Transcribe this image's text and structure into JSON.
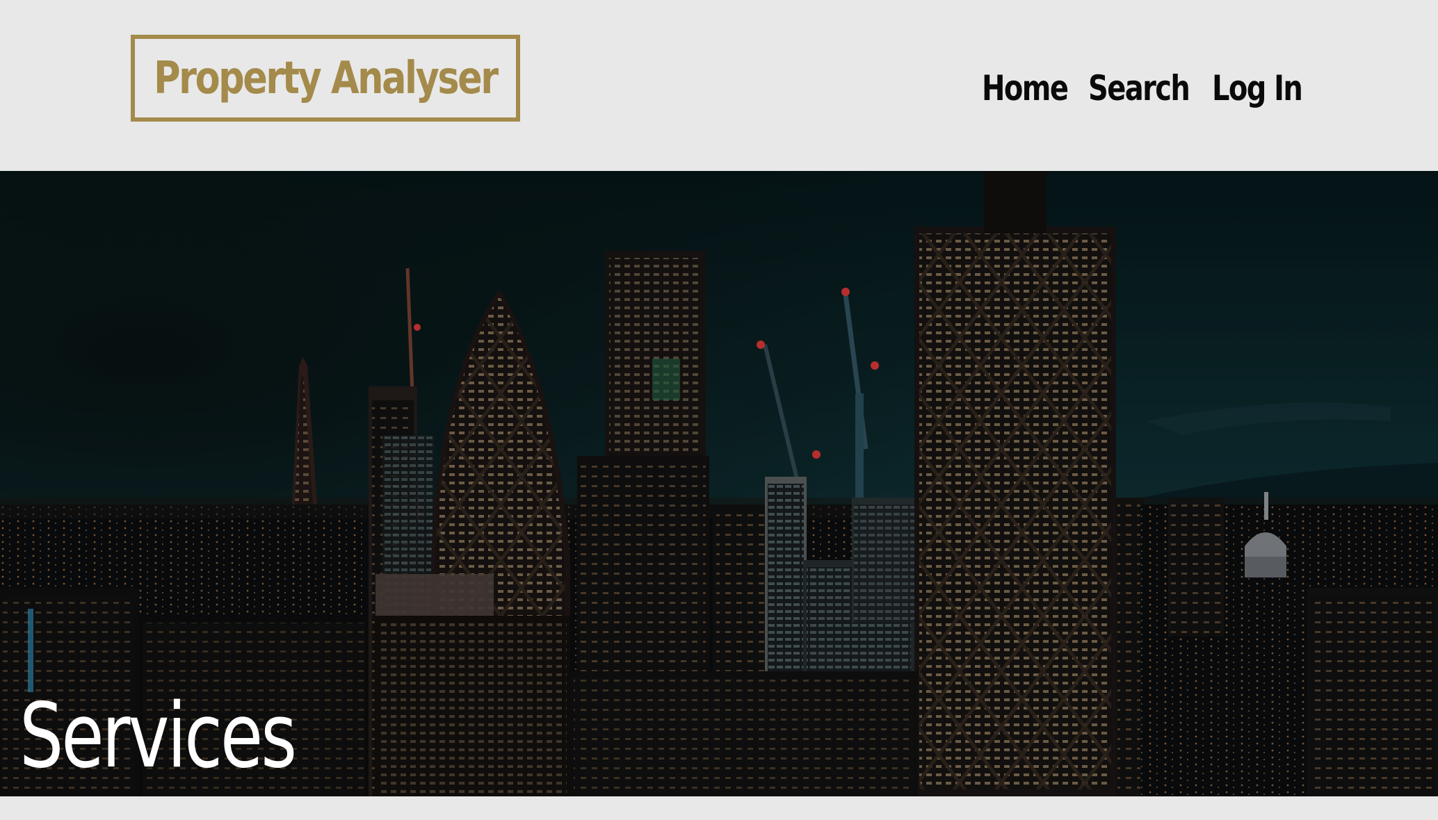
{
  "brand": {
    "name": "Property Analyser",
    "color": "#a48a4b"
  },
  "nav": {
    "items": [
      {
        "label": "Home"
      },
      {
        "label": "Search"
      },
      {
        "label": "Log In"
      }
    ]
  },
  "hero": {
    "title": "Services",
    "image_icon": "city-skyline-night-photo"
  },
  "colors": {
    "page_background": "#e8e8e8",
    "nav_text": "#0a0a0a",
    "hero_title": "#ffffff"
  }
}
